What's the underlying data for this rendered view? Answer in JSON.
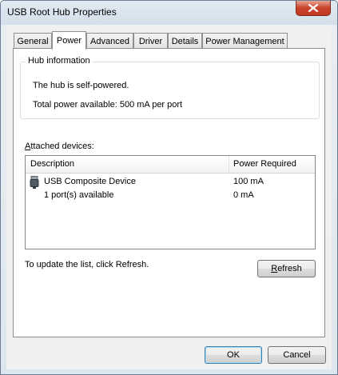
{
  "window": {
    "title": "USB Root Hub Properties"
  },
  "tabs": [
    {
      "label": "General",
      "active": false
    },
    {
      "label": "Power",
      "active": true
    },
    {
      "label": "Advanced",
      "active": false
    },
    {
      "label": "Driver",
      "active": false
    },
    {
      "label": "Details",
      "active": false
    },
    {
      "label": "Power Management",
      "active": false
    }
  ],
  "hub_info": {
    "heading": "Hub information",
    "self_powered": "The hub is self-powered.",
    "total_power": "Total power available:  500 mA per port"
  },
  "attached": {
    "label_prefix": "",
    "label_accel": "A",
    "label_rest": "ttached devices:",
    "columns": [
      "Description",
      "Power Required"
    ],
    "rows": [
      {
        "description": "USB Composite Device",
        "power": "100 mA",
        "icon": "usb-plug-icon"
      },
      {
        "description": "1 port(s) available",
        "power": "0 mA",
        "icon": ""
      }
    ]
  },
  "refresh": {
    "hint": "To update the list, click Refresh.",
    "accel": "R",
    "rest": "efresh"
  },
  "buttons": {
    "ok": "OK",
    "cancel": "Cancel"
  }
}
